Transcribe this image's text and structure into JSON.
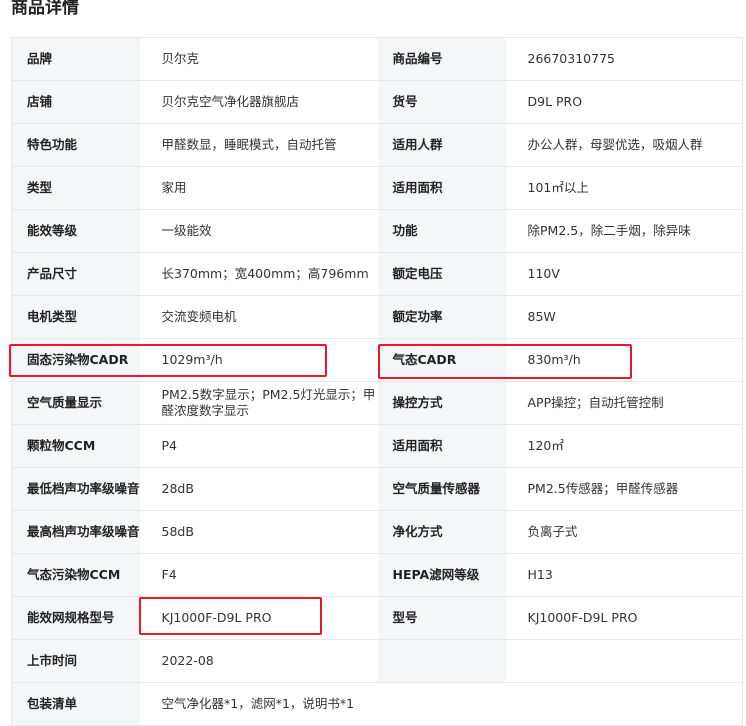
{
  "page_title": "商品详情",
  "rows": [
    {
      "label1": "品牌",
      "value1": "贝尔克",
      "label2": "商品编号",
      "value2": "26670310775"
    },
    {
      "label1": "店铺",
      "value1": "贝尔克空气净化器旗舰店",
      "label2": "货号",
      "value2": "D9L PRO"
    },
    {
      "label1": "特色功能",
      "value1": "甲醛数显，睡眠模式，自动托管",
      "label2": "适用人群",
      "value2": "办公人群，母婴优选，吸烟人群"
    },
    {
      "label1": "类型",
      "value1": "家用",
      "label2": "适用面积",
      "value2": "101㎡以上"
    },
    {
      "label1": "能效等级",
      "value1": "一级能效",
      "label2": "功能",
      "value2": "除PM2.5，除二手烟，除异味"
    },
    {
      "label1": "产品尺寸",
      "value1": "长370mm；宽400mm；高796mm",
      "label2": "额定电压",
      "value2": "110V"
    },
    {
      "label1": "电机类型",
      "value1": "交流变频电机",
      "label2": "额定功率",
      "value2": "85W"
    },
    {
      "label1": "固态污染物CADR",
      "value1": "1029m³/h",
      "label2": "气态CADR",
      "value2": "830m³/h"
    },
    {
      "label1": "空气质量显示",
      "value1": "PM2.5数字显示；PM2.5灯光显示；甲醛浓度数字显示",
      "label2": "操控方式",
      "value2": "APP操控；自动托管控制"
    },
    {
      "label1": "颗粒物CCM",
      "value1": "P4",
      "label2": "适用面积",
      "value2": "120㎡"
    },
    {
      "label1": "最低档声功率级噪音",
      "value1": "28dB",
      "label2": "空气质量传感器",
      "value2": "PM2.5传感器；甲醛传感器"
    },
    {
      "label1": "最高档声功率级噪音",
      "value1": "58dB",
      "label2": "净化方式",
      "value2": "负离子式"
    },
    {
      "label1": "气态污染物CCM",
      "value1": "F4",
      "label2": "HEPA滤网等级",
      "value2": "H13"
    },
    {
      "label1": "能效网规格型号",
      "value1": "KJ1000F-D9L PRO",
      "label2": "型号",
      "value2": "KJ1000F-D9L PRO"
    },
    {
      "label1": "上市时间",
      "value1": "2022-08",
      "label2": "",
      "value2": ""
    },
    {
      "label1": "包装清单",
      "value1": "空气净化器*1，滤网*1，说明书*1",
      "label2": "",
      "value2": ""
    }
  ],
  "highlight_color": "#e8192c"
}
